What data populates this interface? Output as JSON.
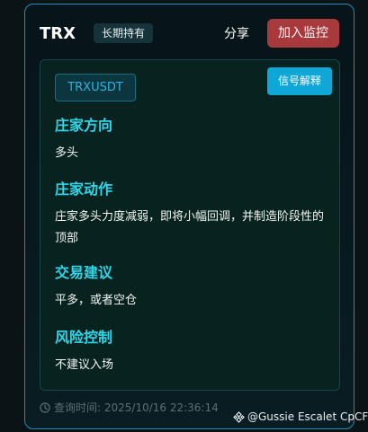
{
  "header": {
    "symbol": "TRX",
    "hold_badge": "长期持有",
    "share_label": "分享",
    "watch_label": "加入监控"
  },
  "panel": {
    "pair": "TRXUSDT",
    "explain_label": "信号解释",
    "sections": [
      {
        "title": "庄家方向",
        "body": "多头"
      },
      {
        "title": "庄家动作",
        "body": "庄家多头力度减弱，即将小幅回调，并制造阶段性的顶部"
      },
      {
        "title": "交易建议",
        "body": "平多，或者空仓"
      },
      {
        "title": "风险控制",
        "body": "不建议入场"
      }
    ]
  },
  "footer": {
    "query_time": "查询时间: 2025/10/16 22:36:14",
    "watermark": "@Gussie Escalet CpCF"
  },
  "icons": {
    "clock": "clock-icon",
    "watermark": "binance-logo-icon"
  },
  "colors": {
    "accent_border": "#1e8fb0",
    "section_title": "#2fd6e8",
    "watch_button": "#a83a3e",
    "explain_button": "#0ea7d8"
  }
}
